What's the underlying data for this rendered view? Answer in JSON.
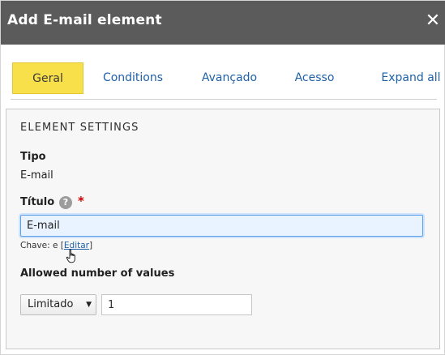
{
  "dialog": {
    "title": "Add E-mail element",
    "close_label": "✕"
  },
  "tabs": [
    {
      "label": "Geral",
      "active": true
    },
    {
      "label": "Conditions",
      "active": false
    },
    {
      "label": "Avançado",
      "active": false
    },
    {
      "label": "Acesso",
      "active": false
    }
  ],
  "expand_all_label": "Expand all",
  "panel": {
    "heading": "ELEMENT SETTINGS",
    "tipo_label": "Tipo",
    "tipo_value": "E-mail",
    "titulo_label": "Título",
    "help_glyph": "?",
    "required_mark": "*",
    "titulo_value": "E-mail",
    "key_prefix": "Chave: e",
    "key_bracket_open": "[",
    "key_edit_link": "Editar",
    "key_bracket_close": "]",
    "allowed_label": "Allowed number of values",
    "limit_select_value": "Limitado",
    "limit_count_value": "1"
  },
  "colors": {
    "titlebar": "#5b5b5b",
    "active_tab": "#f8e04a",
    "link": "#1f61a8",
    "required": "#cc0000",
    "focus_input_bg": "#e9f2ff"
  },
  "icons": {
    "close": "close-icon",
    "help": "help-icon",
    "dropdown": "chevron-down-icon",
    "pointer": "hand-pointer-icon"
  }
}
